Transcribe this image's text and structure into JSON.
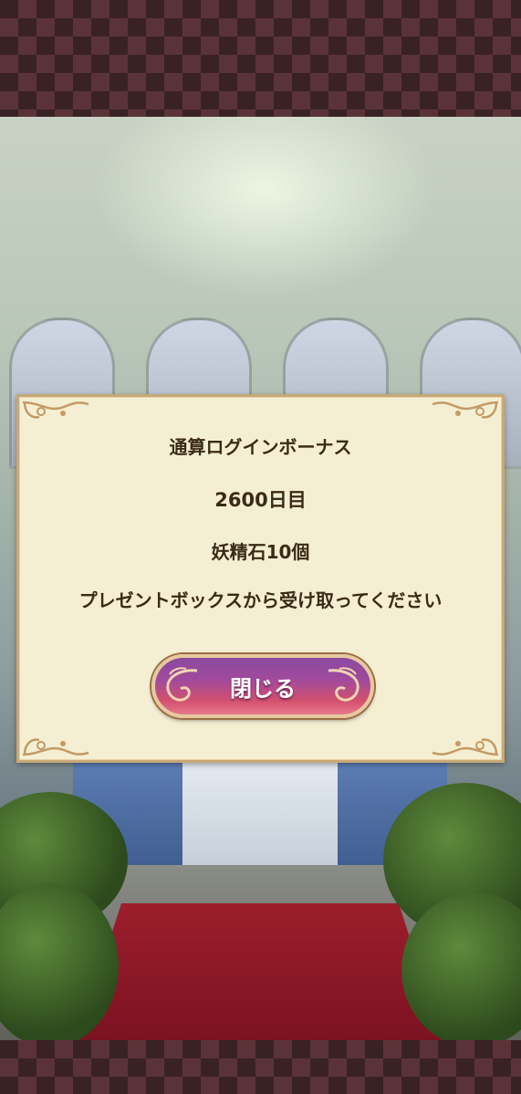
{
  "dialog": {
    "title": "通算ログインボーナス",
    "days": "2600日目",
    "reward": "妖精石10個",
    "message": "プレゼントボックスから受け取ってください",
    "close_label": "閉じる"
  },
  "colors": {
    "dialog_bg": "#f4efd2",
    "dialog_border": "#c9a877",
    "text": "#3b2a18",
    "button_top": "#8a4aa0",
    "button_bottom": "#e8788a",
    "band_dark": "#3a2224",
    "band_light": "#5a3338"
  }
}
